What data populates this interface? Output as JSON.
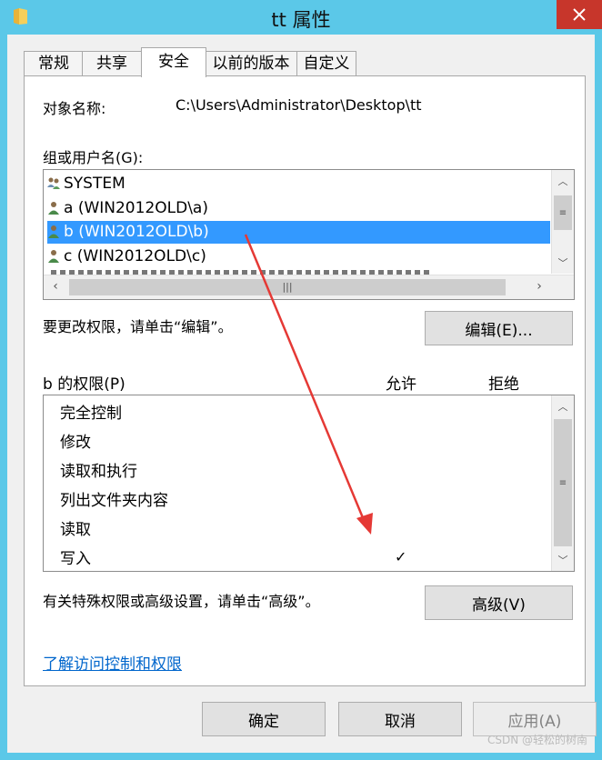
{
  "window": {
    "title": "tt 属性",
    "close_label": "✕"
  },
  "tabs": [
    {
      "label": "常规"
    },
    {
      "label": "共享"
    },
    {
      "label": "安全",
      "active": true
    },
    {
      "label": "以前的版本"
    },
    {
      "label": "自定义"
    }
  ],
  "object": {
    "label": "对象名称:",
    "value": "C:\\Users\\Administrator\\Desktop\\tt"
  },
  "groups": {
    "label": "组或用户名(G):",
    "items": [
      {
        "label": "SYSTEM",
        "icon": "system-group-icon"
      },
      {
        "label": "a (WIN2012OLD\\a)",
        "icon": "user-icon"
      },
      {
        "label": "b (WIN2012OLD\\b)",
        "icon": "user-icon",
        "selected": true
      },
      {
        "label": "c (WIN2012OLD\\c)",
        "icon": "user-icon"
      }
    ]
  },
  "change_hint": "要更改权限，请单击“编辑”。",
  "edit_button": "编辑(E)...",
  "permissions": {
    "title": "b 的权限(P)",
    "allow_label": "允许",
    "deny_label": "拒绝",
    "items": [
      {
        "label": "完全控制",
        "allow": "",
        "deny": ""
      },
      {
        "label": "修改",
        "allow": "",
        "deny": ""
      },
      {
        "label": "读取和执行",
        "allow": "",
        "deny": ""
      },
      {
        "label": "列出文件夹内容",
        "allow": "",
        "deny": ""
      },
      {
        "label": "读取",
        "allow": "",
        "deny": ""
      },
      {
        "label": "写入",
        "allow": "✓",
        "deny": ""
      }
    ]
  },
  "advanced_hint": "有关特殊权限或高级设置，请单击“高级”。",
  "advanced_button": "高级(V)",
  "learn_link": "了解访问控制和权限",
  "buttons": {
    "ok": "确定",
    "cancel": "取消",
    "apply": "应用(A)"
  },
  "watermark": "CSDN @轻松的树南",
  "colors": {
    "titlebar": "#5bc8e8",
    "selection": "#3399ff",
    "annotation_arrow": "#e53935",
    "link": "#0066cc"
  }
}
